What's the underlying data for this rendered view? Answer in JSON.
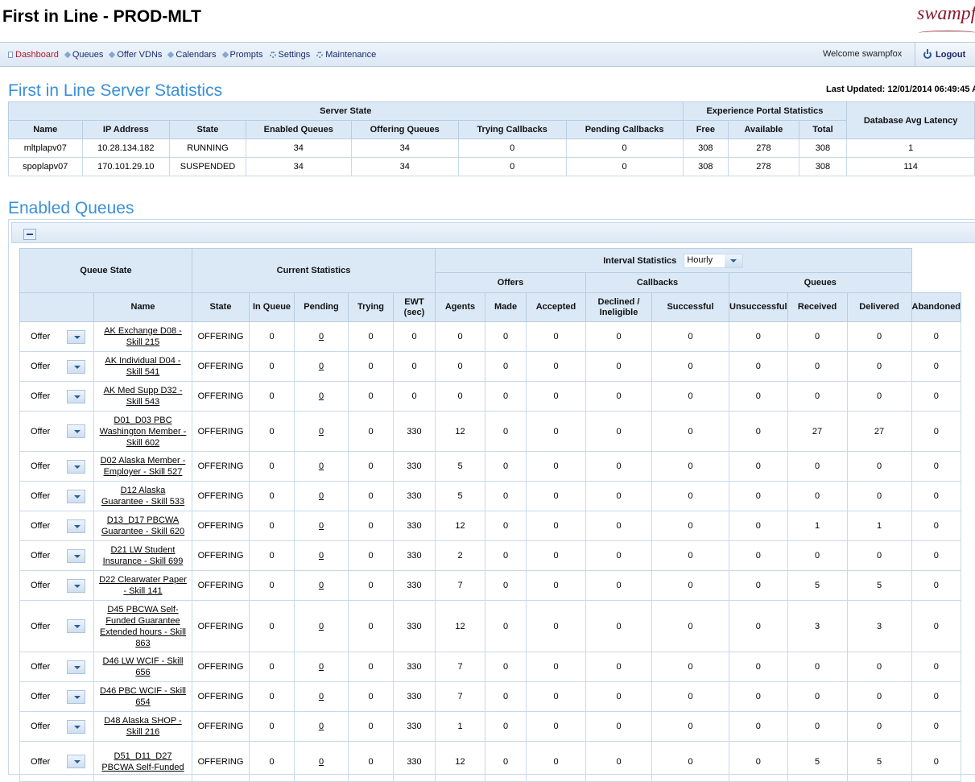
{
  "app": {
    "title": "First in Line - PROD-MLT",
    "logo_text": "swampfox"
  },
  "nav": {
    "items": [
      {
        "label": "Dashboard",
        "icon": "page-icon",
        "active": true
      },
      {
        "label": "Queues",
        "icon": "tag-icon"
      },
      {
        "label": "Offer VDNs",
        "icon": "tag-icon"
      },
      {
        "label": "Calendars",
        "icon": "tag-icon"
      },
      {
        "label": "Prompts",
        "icon": "tag-icon"
      },
      {
        "label": "Settings",
        "icon": "gear-icon"
      },
      {
        "label": "Maintenance",
        "icon": "gear-icon"
      }
    ],
    "welcome": "Welcome swampfox",
    "logout": "Logout"
  },
  "server": {
    "title": "First in Line Server Statistics",
    "last_updated": "Last Updated: 12/01/2014 06:49:45 A",
    "group_server_state": "Server State",
    "group_portal": "Experience Portal Statistics",
    "db_latency_header": "Database Avg Latency",
    "columns": [
      "Name",
      "IP Address",
      "State",
      "Enabled Queues",
      "Offering Queues",
      "Trying Callbacks",
      "Pending Callbacks",
      "Free",
      "Available",
      "Total"
    ],
    "rows": [
      [
        "mltplapv07",
        "10.28.134.182",
        "RUNNING",
        "34",
        "34",
        "0",
        "0",
        "308",
        "278",
        "308",
        "1"
      ],
      [
        "spoplapv07",
        "170.101.29.10",
        "SUSPENDED",
        "34",
        "34",
        "0",
        "0",
        "308",
        "278",
        "308",
        "114"
      ]
    ]
  },
  "queues": {
    "title": "Enabled Queues",
    "group_queue_state": "Queue State",
    "group_current": "Current Statistics",
    "group_interval": "Interval Statistics",
    "interval_value": "Hourly",
    "group_offers": "Offers",
    "group_callbacks": "Callbacks",
    "group_queues": "Queues",
    "columns": {
      "name": "Name",
      "state": "State",
      "in_queue": "In Queue",
      "pending": "Pending",
      "trying": "Trying",
      "ewt": "EWT (sec)",
      "agents": "Agents",
      "made": "Made",
      "accepted": "Accepted",
      "declined": "Declined / Ineligible",
      "successful": "Successful",
      "unsuccessful": "Unsuccessful",
      "received": "Received",
      "delivered": "Delivered",
      "abandoned": "Abandoned"
    },
    "rows": [
      {
        "action": "Offer",
        "name": "AK Exchange D08 - Skill 215",
        "state": "OFFERING",
        "in_queue": "0",
        "pending": "0",
        "trying": "0",
        "ewt": "0",
        "agents": "0",
        "made": "0",
        "accepted": "0",
        "declined": "0",
        "successful": "0",
        "unsuccessful": "0",
        "received": "0",
        "delivered": "0",
        "abandoned": "0"
      },
      {
        "action": "Offer",
        "name": "AK Individual D04 - Skill 541",
        "state": "OFFERING",
        "in_queue": "0",
        "pending": "0",
        "trying": "0",
        "ewt": "0",
        "agents": "0",
        "made": "0",
        "accepted": "0",
        "declined": "0",
        "successful": "0",
        "unsuccessful": "0",
        "received": "0",
        "delivered": "0",
        "abandoned": "0"
      },
      {
        "action": "Offer",
        "name": "AK Med Supp D32 - Skill 543",
        "state": "OFFERING",
        "in_queue": "0",
        "pending": "0",
        "trying": "0",
        "ewt": "0",
        "agents": "0",
        "made": "0",
        "accepted": "0",
        "declined": "0",
        "successful": "0",
        "unsuccessful": "0",
        "received": "0",
        "delivered": "0",
        "abandoned": "0"
      },
      {
        "action": "Offer",
        "name": "D01_D03 PBC Washington Member - Skill 602",
        "state": "OFFERING",
        "in_queue": "0",
        "pending": "0",
        "trying": "0",
        "ewt": "330",
        "agents": "12",
        "made": "0",
        "accepted": "0",
        "declined": "0",
        "successful": "0",
        "unsuccessful": "0",
        "received": "27",
        "delivered": "27",
        "abandoned": "0"
      },
      {
        "action": "Offer",
        "name": "D02 Alaska Member - Employer - Skill 527",
        "state": "OFFERING",
        "in_queue": "0",
        "pending": "0",
        "trying": "0",
        "ewt": "330",
        "agents": "5",
        "made": "0",
        "accepted": "0",
        "declined": "0",
        "successful": "0",
        "unsuccessful": "0",
        "received": "0",
        "delivered": "0",
        "abandoned": "0"
      },
      {
        "action": "Offer",
        "name": "D12 Alaska Guarantee - Skill 533",
        "state": "OFFERING",
        "in_queue": "0",
        "pending": "0",
        "trying": "0",
        "ewt": "330",
        "agents": "5",
        "made": "0",
        "accepted": "0",
        "declined": "0",
        "successful": "0",
        "unsuccessful": "0",
        "received": "0",
        "delivered": "0",
        "abandoned": "0"
      },
      {
        "action": "Offer",
        "name": "D13_D17 PBCWA Guarantee - Skill 620",
        "state": "OFFERING",
        "in_queue": "0",
        "pending": "0",
        "trying": "0",
        "ewt": "330",
        "agents": "12",
        "made": "0",
        "accepted": "0",
        "declined": "0",
        "successful": "0",
        "unsuccessful": "0",
        "received": "1",
        "delivered": "1",
        "abandoned": "0"
      },
      {
        "action": "Offer",
        "name": "D21 LW Student Insurance - Skill 699",
        "state": "OFFERING",
        "in_queue": "0",
        "pending": "0",
        "trying": "0",
        "ewt": "330",
        "agents": "2",
        "made": "0",
        "accepted": "0",
        "declined": "0",
        "successful": "0",
        "unsuccessful": "0",
        "received": "0",
        "delivered": "0",
        "abandoned": "0"
      },
      {
        "action": "Offer",
        "name": "D22 Clearwater Paper - Skill 141",
        "state": "OFFERING",
        "in_queue": "0",
        "pending": "0",
        "trying": "0",
        "ewt": "330",
        "agents": "7",
        "made": "0",
        "accepted": "0",
        "declined": "0",
        "successful": "0",
        "unsuccessful": "0",
        "received": "5",
        "delivered": "5",
        "abandoned": "0"
      },
      {
        "action": "Offer",
        "name": "D45 PBCWA Self-Funded Guarantee Extended hours - Skill 863",
        "state": "OFFERING",
        "in_queue": "0",
        "pending": "0",
        "trying": "0",
        "ewt": "330",
        "agents": "12",
        "made": "0",
        "accepted": "0",
        "declined": "0",
        "successful": "0",
        "unsuccessful": "0",
        "received": "3",
        "delivered": "3",
        "abandoned": "0"
      },
      {
        "action": "Offer",
        "name": "D46 LW WCIF - Skill 656",
        "state": "OFFERING",
        "in_queue": "0",
        "pending": "0",
        "trying": "0",
        "ewt": "330",
        "agents": "7",
        "made": "0",
        "accepted": "0",
        "declined": "0",
        "successful": "0",
        "unsuccessful": "0",
        "received": "0",
        "delivered": "0",
        "abandoned": "0"
      },
      {
        "action": "Offer",
        "name": "D46 PBC WCIF - Skill 654",
        "state": "OFFERING",
        "in_queue": "0",
        "pending": "0",
        "trying": "0",
        "ewt": "330",
        "agents": "7",
        "made": "0",
        "accepted": "0",
        "declined": "0",
        "successful": "0",
        "unsuccessful": "0",
        "received": "0",
        "delivered": "0",
        "abandoned": "0"
      },
      {
        "action": "Offer",
        "name": "D48 Alaska SHOP - Skill 216",
        "state": "OFFERING",
        "in_queue": "0",
        "pending": "0",
        "trying": "0",
        "ewt": "330",
        "agents": "1",
        "made": "0",
        "accepted": "0",
        "declined": "0",
        "successful": "0",
        "unsuccessful": "0",
        "received": "0",
        "delivered": "0",
        "abandoned": "0"
      },
      {
        "action": "Offer",
        "name": "D51_D11_D27 PBCWA Self-Funded",
        "state": "OFFERING",
        "in_queue": "0",
        "pending": "0",
        "trying": "0",
        "ewt": "330",
        "agents": "12",
        "made": "0",
        "accepted": "0",
        "declined": "0",
        "successful": "0",
        "unsuccessful": "0",
        "received": "5",
        "delivered": "5",
        "abandoned": "0"
      }
    ]
  }
}
